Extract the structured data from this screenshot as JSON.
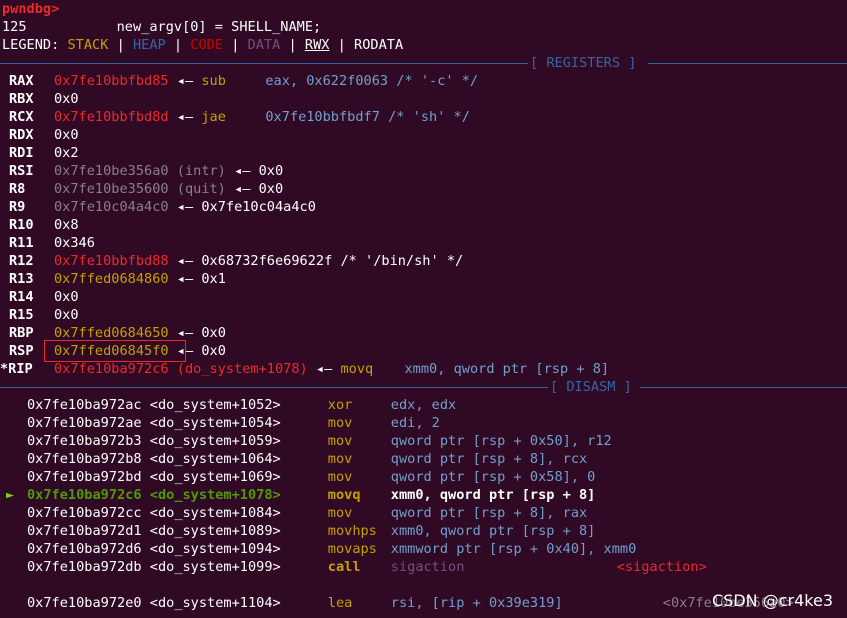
{
  "prompt": "pwndbg>",
  "source_line": {
    "num": "125",
    "code": "new_argv[0] = SHELL_NAME;"
  },
  "legend": {
    "label": "LEGEND:",
    "stack": "STACK",
    "heap": "HEAP",
    "code": "CODE",
    "data": "DATA",
    "rwx": "RWX",
    "rodata": "RODATA",
    "sep": "|"
  },
  "sections": {
    "registers": "[ REGISTERS ]",
    "disasm": "[ DISASM ]"
  },
  "arrow": "◂—",
  "registers": [
    {
      "name": "RAX",
      "value": "0x7fe10bbfbd85",
      "color": "red",
      "rest_ins": "sub",
      "rest_ops": "eax, 0x622f0063 /* '-c' */"
    },
    {
      "name": "RBX",
      "value": "0x0",
      "color": "wht"
    },
    {
      "name": "RCX",
      "value": "0x7fe10bbfbd8d",
      "color": "red",
      "rest_ins": "jae",
      "rest_ops": "0x7fe10bbfbdf7 /* 'sh' */"
    },
    {
      "name": "RDX",
      "value": "0x0",
      "color": "wht"
    },
    {
      "name": "RDI",
      "value": "0x2",
      "color": "wht"
    },
    {
      "name": "RSI",
      "value": "0x7fe10be356a0",
      "color": "gry",
      "sym": "(intr)",
      "target": "0x0"
    },
    {
      "name": "R8",
      "value": "0x7fe10be35600",
      "color": "gry",
      "sym": "(quit)",
      "target": "0x0"
    },
    {
      "name": "R9",
      "value": "0x7fe10c04a4c0",
      "color": "gry",
      "target": "0x7fe10c04a4c0"
    },
    {
      "name": "R10",
      "value": "0x8",
      "color": "wht"
    },
    {
      "name": "R11",
      "value": "0x346",
      "color": "wht"
    },
    {
      "name": "R12",
      "value": "0x7fe10bbfbd88",
      "color": "red",
      "target": "0x68732f6e69622f /* '/bin/sh' */"
    },
    {
      "name": "R13",
      "value": "0x7ffed0684860",
      "color": "yel",
      "target": "0x1"
    },
    {
      "name": "R14",
      "value": "0x0",
      "color": "wht"
    },
    {
      "name": "R15",
      "value": "0x0",
      "color": "wht"
    },
    {
      "name": "RBP",
      "value": "0x7ffed0684650",
      "color": "yel",
      "target": "0x0"
    },
    {
      "name": "RSP",
      "value": "0x7ffed06845f0",
      "color": "yel",
      "target": "0x0"
    },
    {
      "name": "*RIP",
      "value": "0x7fe10ba972c6",
      "color": "red",
      "sym": "(do_system+1078)",
      "rest_ins": "movq",
      "rest_ops_pre": "xmm0, ",
      "rest_ops_blue": "qword ptr",
      "rest_ops_post": " [rsp + 8]"
    }
  ],
  "disasm": [
    {
      "addr": "0x7fe10ba972ac",
      "sym": "<do_system+1052>",
      "ins": "xor",
      "ops": "edx, edx"
    },
    {
      "addr": "0x7fe10ba972ae",
      "sym": "<do_system+1054>",
      "ins": "mov",
      "ops": "edi, 2"
    },
    {
      "addr": "0x7fe10ba972b3",
      "sym": "<do_system+1059>",
      "ins": "mov",
      "ops": "qword ptr [rsp + 0x50], r12"
    },
    {
      "addr": "0x7fe10ba972b8",
      "sym": "<do_system+1064>",
      "ins": "mov",
      "ops": "qword ptr [rsp + 8], rcx"
    },
    {
      "addr": "0x7fe10ba972bd",
      "sym": "<do_system+1069>",
      "ins": "mov",
      "ops": "qword ptr [rsp + 0x58], 0"
    },
    {
      "addr": "0x7fe10ba972c6",
      "sym": "<do_system+1078>",
      "ins": "movq",
      "ops": "xmm0, qword ptr [rsp + 8]",
      "current": true
    },
    {
      "addr": "0x7fe10ba972cc",
      "sym": "<do_system+1084>",
      "ins": "mov",
      "ops": "qword ptr [rsp + 8], rax"
    },
    {
      "addr": "0x7fe10ba972d1",
      "sym": "<do_system+1089>",
      "ins": "movhps",
      "ops": "xmm0, qword ptr [rsp + 8]"
    },
    {
      "addr": "0x7fe10ba972d6",
      "sym": "<do_system+1094>",
      "ins": "movaps",
      "ops": "xmmword ptr [rsp + 0x40], xmm0"
    },
    {
      "addr": "0x7fe10ba972db",
      "sym": "<do_system+1099>",
      "ins": "call",
      "ops": "sigaction",
      "target": "<sigaction>"
    },
    {
      "addr": "0x7fe10ba972e0",
      "sym": "<do_system+1104>",
      "ins": "lea",
      "ops": "rsi, [rip + 0x39e319]",
      "target": "<0x7fe10be356a0>"
    }
  ],
  "current_marker": "►",
  "watermark": "CSDN @cr4ke3",
  "colors": {
    "background": "#300a24",
    "stack": "#c4a000",
    "heap": "#3465a4",
    "code": "#cc0000",
    "data": "#75507b",
    "highlight_box": "#ef2929"
  }
}
